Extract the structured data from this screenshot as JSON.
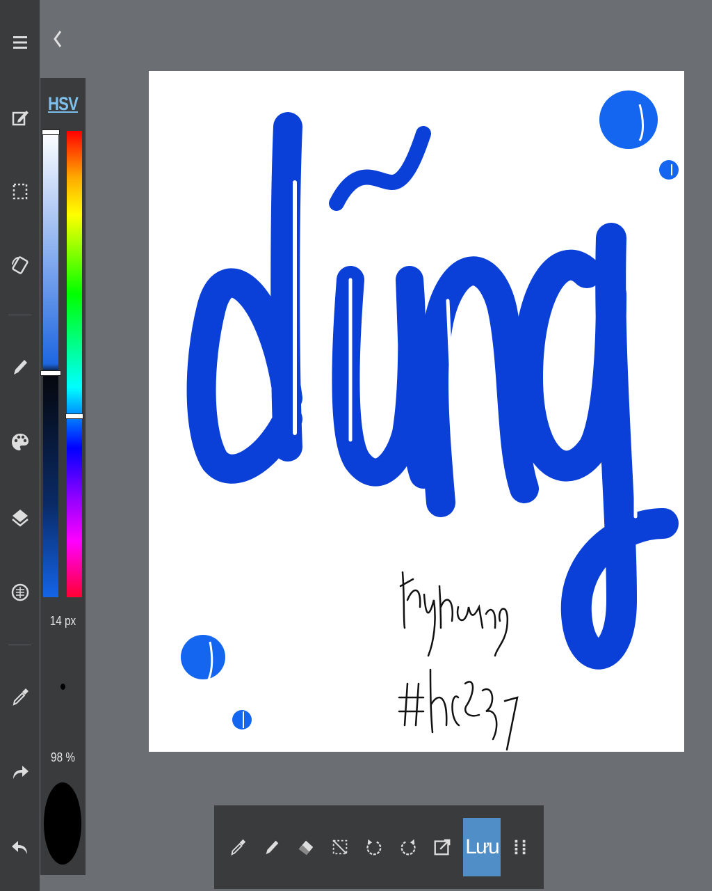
{
  "left_toolbar": {
    "items": [
      {
        "name": "menu-icon"
      },
      {
        "name": "edit-icon"
      },
      {
        "name": "selection-icon"
      },
      {
        "name": "rotate-icon"
      },
      {
        "name": "pen-icon"
      },
      {
        "name": "palette-icon"
      },
      {
        "name": "layers-icon"
      },
      {
        "name": "materials-icon"
      },
      {
        "name": "eyedropper-icon"
      },
      {
        "name": "redo-icon"
      },
      {
        "name": "undo-icon"
      }
    ]
  },
  "color_panel": {
    "mode_label": "HSV",
    "brush_size": "14 px",
    "opacity": "98 %",
    "current_color": "#000000",
    "sv_level": 0.52,
    "hue_level": 0.61
  },
  "canvas": {
    "artwork_main_text": "dũng",
    "signature_line1": "thuyhoang",
    "signature_line2": "#hd297",
    "stroke_color": "#0a40d8",
    "bubble_color": "#1466f0"
  },
  "bottom_toolbar": {
    "items": [
      {
        "name": "eyedropper-icon"
      },
      {
        "name": "pen-icon"
      },
      {
        "name": "eraser-icon"
      },
      {
        "name": "clear-selection-icon"
      },
      {
        "name": "rotate-left-icon"
      },
      {
        "name": "rotate-right-icon"
      },
      {
        "name": "export-icon"
      }
    ],
    "save_label": "Lưu",
    "more_icon": "grid-dots-icon"
  },
  "colors": {
    "toolbar_bg": "#3a3b3d",
    "workspace_bg": "#6b6e72",
    "accent": "#4f8ec6",
    "hsv_label": "#7ec0ec"
  }
}
